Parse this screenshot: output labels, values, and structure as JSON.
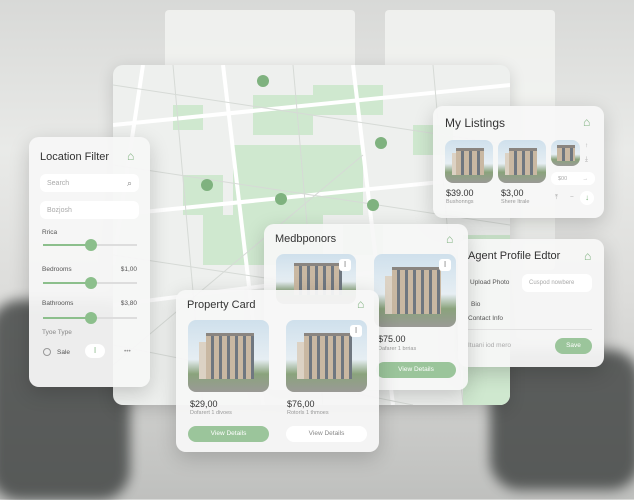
{
  "colors": {
    "accent": "#8cbf8c",
    "panel": "#f6f7f6",
    "map_block": "#cfe8cf"
  },
  "location_filter": {
    "title": "Location Filter",
    "search_placeholder": "Search",
    "location_value": "Bozjosh",
    "price_label": "Rrica",
    "bedrooms_label": "Bedrooms",
    "bedrooms_value": "$1,00",
    "bathrooms_label": "Bathrooms",
    "bathrooms_value": "$3,80",
    "type_label": "Tyoe Type",
    "sale_label": "Sale",
    "more": "•••",
    "sliders": {
      "price": 0.5,
      "bedrooms": 0.5,
      "bathrooms": 0.5
    }
  },
  "my_listings": {
    "title": "My Listings",
    "items": [
      {
        "price": "$39.00",
        "sub": "Bushonngs"
      },
      {
        "price": "$3,00",
        "sub": "Shere Itrale"
      }
    ],
    "select_value": "$00"
  },
  "agent_profile": {
    "title": "Agent Profile Edtor",
    "upload_label": "Upload Photo",
    "upload_placeholder": "Cuspod nowbere",
    "bio_label": "Bio",
    "contact_label": "Contact Info",
    "footer_text": "Ituani iod mero",
    "save_label": "Save"
  },
  "medbponors": {
    "title": "Medbponors",
    "items": [
      {
        "price": "$75.00",
        "sub": "Dafarer 1 brrias",
        "button": "View Details"
      }
    ]
  },
  "property_card": {
    "title": "Property Card",
    "items": [
      {
        "price": "$29,00",
        "sub": "Dofarert 1 divoes",
        "button": "View Details"
      },
      {
        "price": "$76,00",
        "sub": "Rotorls 1 thmoes",
        "button": "View Details"
      }
    ]
  }
}
